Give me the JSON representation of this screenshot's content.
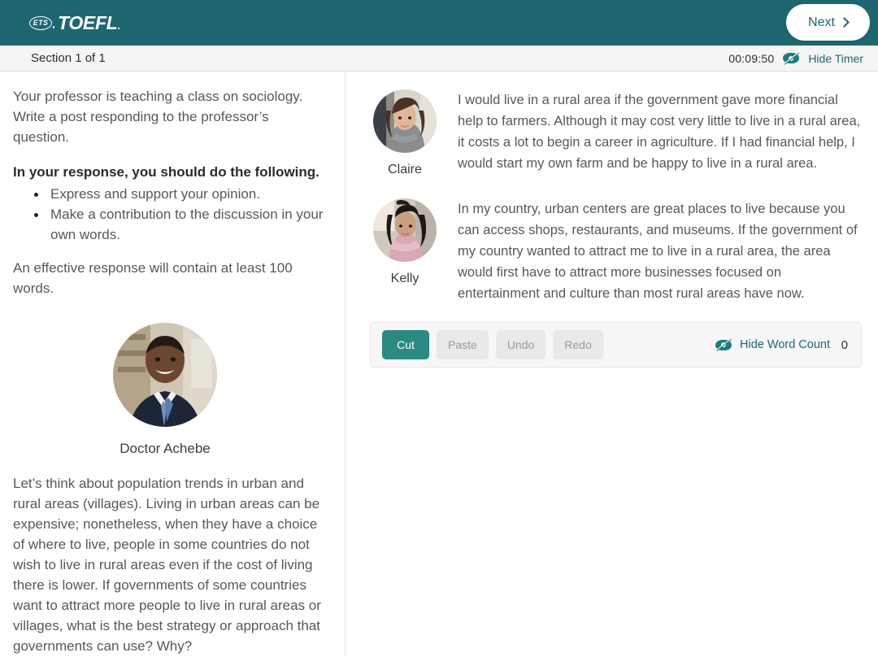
{
  "header": {
    "brand_mark": "ETS",
    "brand_name": "TOEFL",
    "brand_tm": ".",
    "next_label": "Next",
    "next_icon": "chevron-right-icon",
    "brand_color": "#1e6670"
  },
  "section_bar": {
    "section_label": "Section 1 of 1",
    "timer_value": "00:09:50",
    "hide_timer_label": "Hide Timer",
    "hide_timer_icon": "eye-slash-icon",
    "link_color": "#1e6670"
  },
  "left_panel": {
    "intro": "Your professor is teaching a class on sociology. Write a post responding to the professor’s question.",
    "instruction_heading": "In your response, you should do the following.",
    "instruction_items": [
      "Express and support your opinion.",
      "Make a contribution to the discussion in your own words."
    ],
    "word_requirement": "An effective response will contain at least 100 words.",
    "professor": {
      "name": "Doctor Achebe",
      "avatar_icon": "professor-avatar",
      "post": "Let’s think about population trends in urban and rural areas (villages). Living in urban areas can be expensive; nonetheless, when they have a choice of where to live, people in some countries do not wish to live in rural areas even if the cost of living there is lower. If governments of some countries want to attract more people to live in rural areas or villages, what is the best strategy or approach that governments can use? Why?"
    }
  },
  "right_panel": {
    "posts": [
      {
        "name": "Claire",
        "avatar_icon": "student-avatar-claire",
        "text": "I would live in a rural area if the government gave more financial help to farmers. Although it may cost very little to live in a rural area, it costs a lot to begin a career in agriculture. If I had financial help, I would start my own farm and be happy to live in a rural area."
      },
      {
        "name": "Kelly",
        "avatar_icon": "student-avatar-kelly",
        "text": "In my country, urban centers are great places to live because you can access shops, restaurants, and museums. If the government of my country wanted to attract me to live in a rural area, the area would first have to attract more businesses focused on entertainment and culture than most rural areas have now."
      }
    ],
    "toolbar": {
      "cut_label": "Cut",
      "paste_label": "Paste",
      "undo_label": "Undo",
      "redo_label": "Redo",
      "hide_word_count_label": "Hide Word Count",
      "hide_word_count_icon": "eye-slash-icon",
      "word_count": "0",
      "active_color": "#2a8a82",
      "disabled_color": "#e9e9e9"
    },
    "response_value": "",
    "response_placeholder": ""
  }
}
